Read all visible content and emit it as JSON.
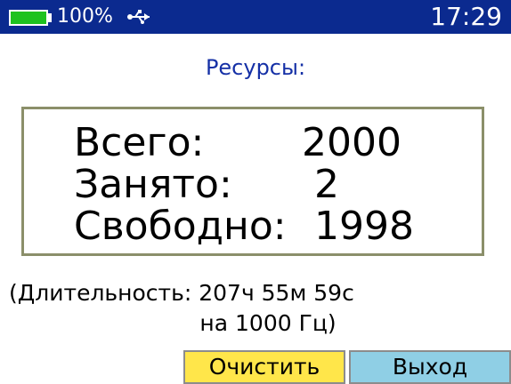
{
  "status_bar": {
    "battery_percent": "100%",
    "battery_level": 1.0,
    "usb_icon": "usb-icon",
    "time": "17:29",
    "background_color": "#0b2a8f",
    "battery_color": "#1ec21e"
  },
  "title": "Ресурсы:",
  "resources": {
    "total_label": "Всего:",
    "total_value": "2000",
    "used_label": "Занято:",
    "used_value": "2",
    "free_label": "Свободно:",
    "free_value": "1998"
  },
  "duration": {
    "line1": "(Длительность: 207ч 55м 59с",
    "line2": "на 1000 Гц)"
  },
  "buttons": {
    "clear_label": "Очистить",
    "exit_label": "Выход",
    "clear_color": "#ffe64a",
    "exit_color": "#8fcfe5"
  }
}
